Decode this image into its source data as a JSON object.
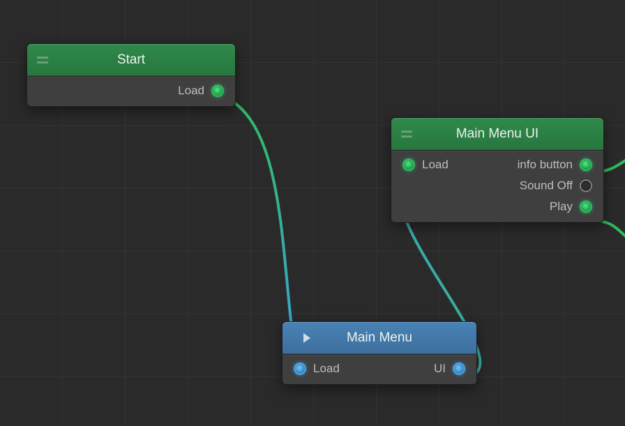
{
  "nodes": {
    "start": {
      "title": "Start",
      "outputs": {
        "load": "Load"
      }
    },
    "mainMenuUi": {
      "title": "Main Menu UI",
      "inputs": {
        "load": "Load"
      },
      "outputs": {
        "infoButton": "info button",
        "soundOff": "Sound Off",
        "play": "Play"
      }
    },
    "mainMenu": {
      "title": "Main Menu",
      "inputs": {
        "load": "Load"
      },
      "outputs": {
        "ui": "UI"
      }
    }
  },
  "colors": {
    "greenHeader": "#2c8044",
    "blueHeader": "#4079ab",
    "wireGreen": "#2fbb5f",
    "wireBlue": "#3fa0e0"
  }
}
